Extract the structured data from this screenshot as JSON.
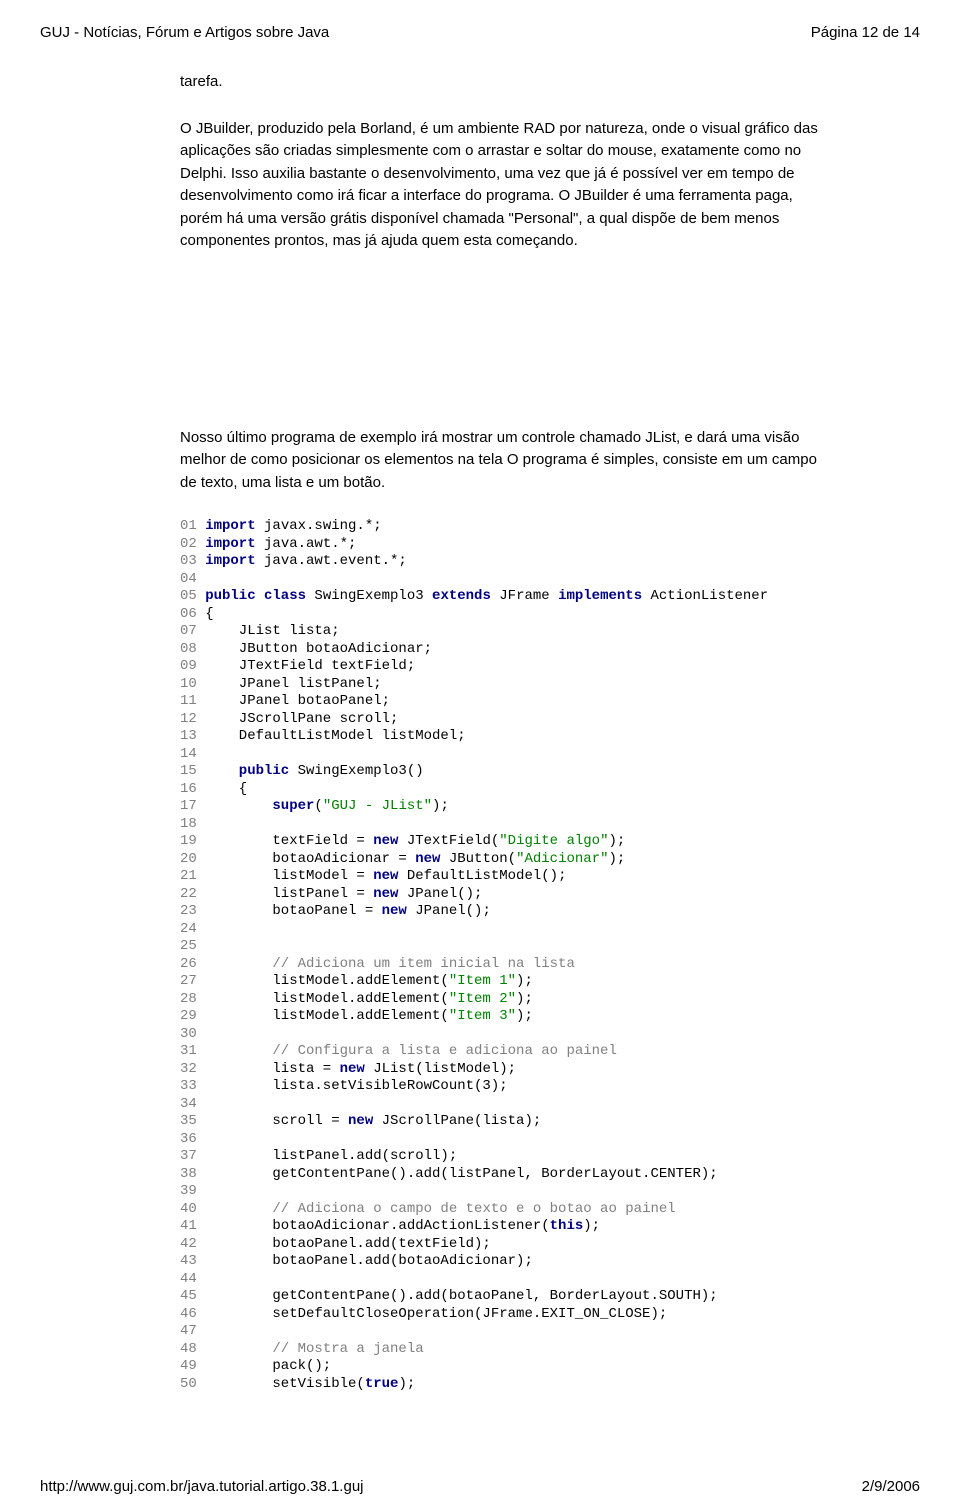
{
  "header": {
    "title_left": "GUJ - Notícias, Fórum e Artigos sobre Java",
    "title_right": "Página 12 de 14"
  },
  "footer": {
    "url": "http://www.guj.com.br/java.tutorial.artigo.38.1.guj",
    "date": "2/9/2006"
  },
  "text": {
    "p1": "tarefa.",
    "p2": "O JBuilder, produzido pela Borland, é um ambiente RAD por natureza, onde o visual gráfico das aplicações são criadas simplesmente com o arrastar e soltar do mouse, exatamente como no Delphi. Isso auxilia bastante o desenvolvimento, uma vez que já é possível ver em tempo de desenvolvimento como irá ficar a interface do programa. O JBuilder é uma ferramenta paga, porém há uma versão grátis disponível chamada \"Personal\", a qual dispõe de bem menos componentes prontos, mas já ajuda quem esta começando.",
    "p3": "Nosso último programa de exemplo irá mostrar um controle chamado JList, e dará uma visão melhor de como posicionar os elementos na tela O programa é simples, consiste em um campo de texto, uma lista e um botão."
  },
  "code": {
    "lines": [
      {
        "n": "01",
        "kind": "code",
        "parts": [
          {
            "t": "kw",
            "v": "import"
          },
          {
            "t": "txt",
            "v": " javax.swing.*;"
          }
        ]
      },
      {
        "n": "02",
        "kind": "code",
        "parts": [
          {
            "t": "kw",
            "v": "import"
          },
          {
            "t": "txt",
            "v": " java.awt.*;"
          }
        ]
      },
      {
        "n": "03",
        "kind": "code",
        "parts": [
          {
            "t": "kw",
            "v": "import"
          },
          {
            "t": "txt",
            "v": " java.awt.event.*;"
          }
        ]
      },
      {
        "n": "04",
        "kind": "blank"
      },
      {
        "n": "05",
        "kind": "code",
        "parts": [
          {
            "t": "kw",
            "v": "public class"
          },
          {
            "t": "txt",
            "v": " SwingExemplo3 "
          },
          {
            "t": "kw",
            "v": "extends"
          },
          {
            "t": "txt",
            "v": " JFrame "
          },
          {
            "t": "kw",
            "v": "implements"
          },
          {
            "t": "txt",
            "v": " ActionListener"
          }
        ]
      },
      {
        "n": "06",
        "kind": "code",
        "parts": [
          {
            "t": "txt",
            "v": "{"
          }
        ]
      },
      {
        "n": "07",
        "kind": "code",
        "parts": [
          {
            "t": "txt",
            "v": "    JList lista;"
          }
        ]
      },
      {
        "n": "08",
        "kind": "code",
        "parts": [
          {
            "t": "txt",
            "v": "    JButton botaoAdicionar;"
          }
        ]
      },
      {
        "n": "09",
        "kind": "code",
        "parts": [
          {
            "t": "txt",
            "v": "    JTextField textField;"
          }
        ]
      },
      {
        "n": "10",
        "kind": "code",
        "parts": [
          {
            "t": "txt",
            "v": "    JPanel listPanel;"
          }
        ]
      },
      {
        "n": "11",
        "kind": "code",
        "parts": [
          {
            "t": "txt",
            "v": "    JPanel botaoPanel;"
          }
        ]
      },
      {
        "n": "12",
        "kind": "code",
        "parts": [
          {
            "t": "txt",
            "v": "    JScrollPane scroll;"
          }
        ]
      },
      {
        "n": "13",
        "kind": "code",
        "parts": [
          {
            "t": "txt",
            "v": "    DefaultListModel listModel;"
          }
        ]
      },
      {
        "n": "14",
        "kind": "blank"
      },
      {
        "n": "15",
        "kind": "code",
        "parts": [
          {
            "t": "txt",
            "v": "    "
          },
          {
            "t": "kw",
            "v": "public"
          },
          {
            "t": "txt",
            "v": " SwingExemplo3()"
          }
        ]
      },
      {
        "n": "16",
        "kind": "code",
        "parts": [
          {
            "t": "txt",
            "v": "    {"
          }
        ]
      },
      {
        "n": "17",
        "kind": "code",
        "parts": [
          {
            "t": "txt",
            "v": "        "
          },
          {
            "t": "kw",
            "v": "super"
          },
          {
            "t": "txt",
            "v": "("
          },
          {
            "t": "str",
            "v": "\"GUJ - JList\""
          },
          {
            "t": "txt",
            "v": ");"
          }
        ]
      },
      {
        "n": "18",
        "kind": "blank"
      },
      {
        "n": "19",
        "kind": "code",
        "parts": [
          {
            "t": "txt",
            "v": "        textField = "
          },
          {
            "t": "kw",
            "v": "new"
          },
          {
            "t": "txt",
            "v": " JTextField("
          },
          {
            "t": "str",
            "v": "\"Digite algo\""
          },
          {
            "t": "txt",
            "v": ");"
          }
        ]
      },
      {
        "n": "20",
        "kind": "code",
        "parts": [
          {
            "t": "txt",
            "v": "        botaoAdicionar = "
          },
          {
            "t": "kw",
            "v": "new"
          },
          {
            "t": "txt",
            "v": " JButton("
          },
          {
            "t": "str",
            "v": "\"Adicionar\""
          },
          {
            "t": "txt",
            "v": ");"
          }
        ]
      },
      {
        "n": "21",
        "kind": "code",
        "parts": [
          {
            "t": "txt",
            "v": "        listModel = "
          },
          {
            "t": "kw",
            "v": "new"
          },
          {
            "t": "txt",
            "v": " DefaultListModel();"
          }
        ]
      },
      {
        "n": "22",
        "kind": "code",
        "parts": [
          {
            "t": "txt",
            "v": "        listPanel = "
          },
          {
            "t": "kw",
            "v": "new"
          },
          {
            "t": "txt",
            "v": " JPanel();"
          }
        ]
      },
      {
        "n": "23",
        "kind": "code",
        "parts": [
          {
            "t": "txt",
            "v": "        botaoPanel = "
          },
          {
            "t": "kw",
            "v": "new"
          },
          {
            "t": "txt",
            "v": " JPanel();"
          }
        ]
      },
      {
        "n": "24",
        "kind": "blank"
      },
      {
        "n": "25",
        "kind": "blank"
      },
      {
        "n": "26",
        "kind": "code",
        "parts": [
          {
            "t": "txt",
            "v": "        "
          },
          {
            "t": "cmt",
            "v": "// Adiciona um item inicial na lista"
          }
        ]
      },
      {
        "n": "27",
        "kind": "code",
        "parts": [
          {
            "t": "txt",
            "v": "        listModel.addElement("
          },
          {
            "t": "str",
            "v": "\"Item 1\""
          },
          {
            "t": "txt",
            "v": ");"
          }
        ]
      },
      {
        "n": "28",
        "kind": "code",
        "parts": [
          {
            "t": "txt",
            "v": "        listModel.addElement("
          },
          {
            "t": "str",
            "v": "\"Item 2\""
          },
          {
            "t": "txt",
            "v": ");"
          }
        ]
      },
      {
        "n": "29",
        "kind": "code",
        "parts": [
          {
            "t": "txt",
            "v": "        listModel.addElement("
          },
          {
            "t": "str",
            "v": "\"Item 3\""
          },
          {
            "t": "txt",
            "v": ");"
          }
        ]
      },
      {
        "n": "30",
        "kind": "blank"
      },
      {
        "n": "31",
        "kind": "code",
        "parts": [
          {
            "t": "txt",
            "v": "        "
          },
          {
            "t": "cmt",
            "v": "// Configura a lista e adiciona ao painel"
          }
        ]
      },
      {
        "n": "32",
        "kind": "code",
        "parts": [
          {
            "t": "txt",
            "v": "        lista = "
          },
          {
            "t": "kw",
            "v": "new"
          },
          {
            "t": "txt",
            "v": " JList(listModel);"
          }
        ]
      },
      {
        "n": "33",
        "kind": "code",
        "parts": [
          {
            "t": "txt",
            "v": "        lista.setVisibleRowCount(3);"
          }
        ]
      },
      {
        "n": "34",
        "kind": "blank"
      },
      {
        "n": "35",
        "kind": "code",
        "parts": [
          {
            "t": "txt",
            "v": "        scroll = "
          },
          {
            "t": "kw",
            "v": "new"
          },
          {
            "t": "txt",
            "v": " JScrollPane(lista);"
          }
        ]
      },
      {
        "n": "36",
        "kind": "blank"
      },
      {
        "n": "37",
        "kind": "code",
        "parts": [
          {
            "t": "txt",
            "v": "        listPanel.add(scroll);"
          }
        ]
      },
      {
        "n": "38",
        "kind": "code",
        "parts": [
          {
            "t": "txt",
            "v": "        getContentPane().add(listPanel, BorderLayout.CENTER);"
          }
        ]
      },
      {
        "n": "39",
        "kind": "blank"
      },
      {
        "n": "40",
        "kind": "code",
        "parts": [
          {
            "t": "txt",
            "v": "        "
          },
          {
            "t": "cmt",
            "v": "// Adiciona o campo de texto e o botao ao painel"
          }
        ]
      },
      {
        "n": "41",
        "kind": "code",
        "parts": [
          {
            "t": "txt",
            "v": "        botaoAdicionar.addActionListener("
          },
          {
            "t": "kw",
            "v": "this"
          },
          {
            "t": "txt",
            "v": ");"
          }
        ]
      },
      {
        "n": "42",
        "kind": "code",
        "parts": [
          {
            "t": "txt",
            "v": "        botaoPanel.add(textField);"
          }
        ]
      },
      {
        "n": "43",
        "kind": "code",
        "parts": [
          {
            "t": "txt",
            "v": "        botaoPanel.add(botaoAdicionar);"
          }
        ]
      },
      {
        "n": "44",
        "kind": "blank"
      },
      {
        "n": "45",
        "kind": "code",
        "parts": [
          {
            "t": "txt",
            "v": "        getContentPane().add(botaoPanel, BorderLayout.SOUTH);"
          }
        ]
      },
      {
        "n": "46",
        "kind": "code",
        "parts": [
          {
            "t": "txt",
            "v": "        setDefaultCloseOperation(JFrame.EXIT_ON_CLOSE);"
          }
        ]
      },
      {
        "n": "47",
        "kind": "blank"
      },
      {
        "n": "48",
        "kind": "code",
        "parts": [
          {
            "t": "txt",
            "v": "        "
          },
          {
            "t": "cmt",
            "v": "// Mostra a janela"
          }
        ]
      },
      {
        "n": "49",
        "kind": "code",
        "parts": [
          {
            "t": "txt",
            "v": "        pack();"
          }
        ]
      },
      {
        "n": "50",
        "kind": "code",
        "parts": [
          {
            "t": "txt",
            "v": "        setVisible("
          },
          {
            "t": "kw",
            "v": "true"
          },
          {
            "t": "txt",
            "v": ");"
          }
        ]
      }
    ]
  }
}
